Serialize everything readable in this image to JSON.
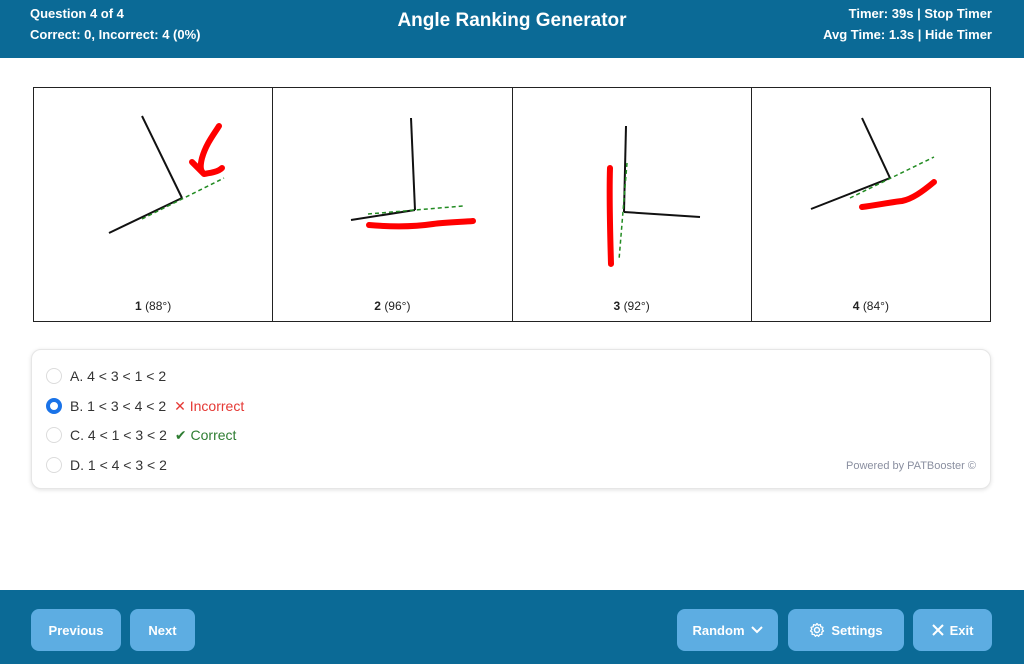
{
  "header": {
    "question_progress": "Question 4 of 4",
    "score": "Correct: 0, Incorrect: 4 (0%)",
    "title": "Angle Ranking Generator",
    "timer": "Timer: 39s",
    "stop_timer": "Stop Timer",
    "avg_time": "Avg Time: 1.3s",
    "hide_timer": "Hide Timer",
    "separator": "|"
  },
  "angles": [
    {
      "number": "1",
      "degrees": "(88°)"
    },
    {
      "number": "2",
      "degrees": "(96°)"
    },
    {
      "number": "3",
      "degrees": "(92°)"
    },
    {
      "number": "4",
      "degrees": "(84°)"
    }
  ],
  "options": [
    {
      "label": "A. 4 < 3 < 1 < 2",
      "selected": false,
      "feedback": ""
    },
    {
      "label": "B. 1 < 3 < 4 < 2",
      "selected": true,
      "feedback": "✕ Incorrect"
    },
    {
      "label": "C. 4 < 1 < 3 < 2",
      "selected": false,
      "feedback": "✔ Correct"
    },
    {
      "label": "D. 1 < 4 < 3 < 2",
      "selected": false,
      "feedback": ""
    }
  ],
  "powered_by": "Powered by PATBooster ©",
  "footer": {
    "previous": "Previous",
    "next": "Next",
    "random": "Random",
    "settings": "Settings",
    "exit": "Exit"
  },
  "colors": {
    "brand": "#0b6a96",
    "button": "#5dade2",
    "annotation": "#ff0000",
    "guide": "#228b22",
    "selected_radio": "#1a73e8"
  },
  "icons": [
    "chevron-down-icon",
    "gear-icon",
    "close-icon"
  ]
}
